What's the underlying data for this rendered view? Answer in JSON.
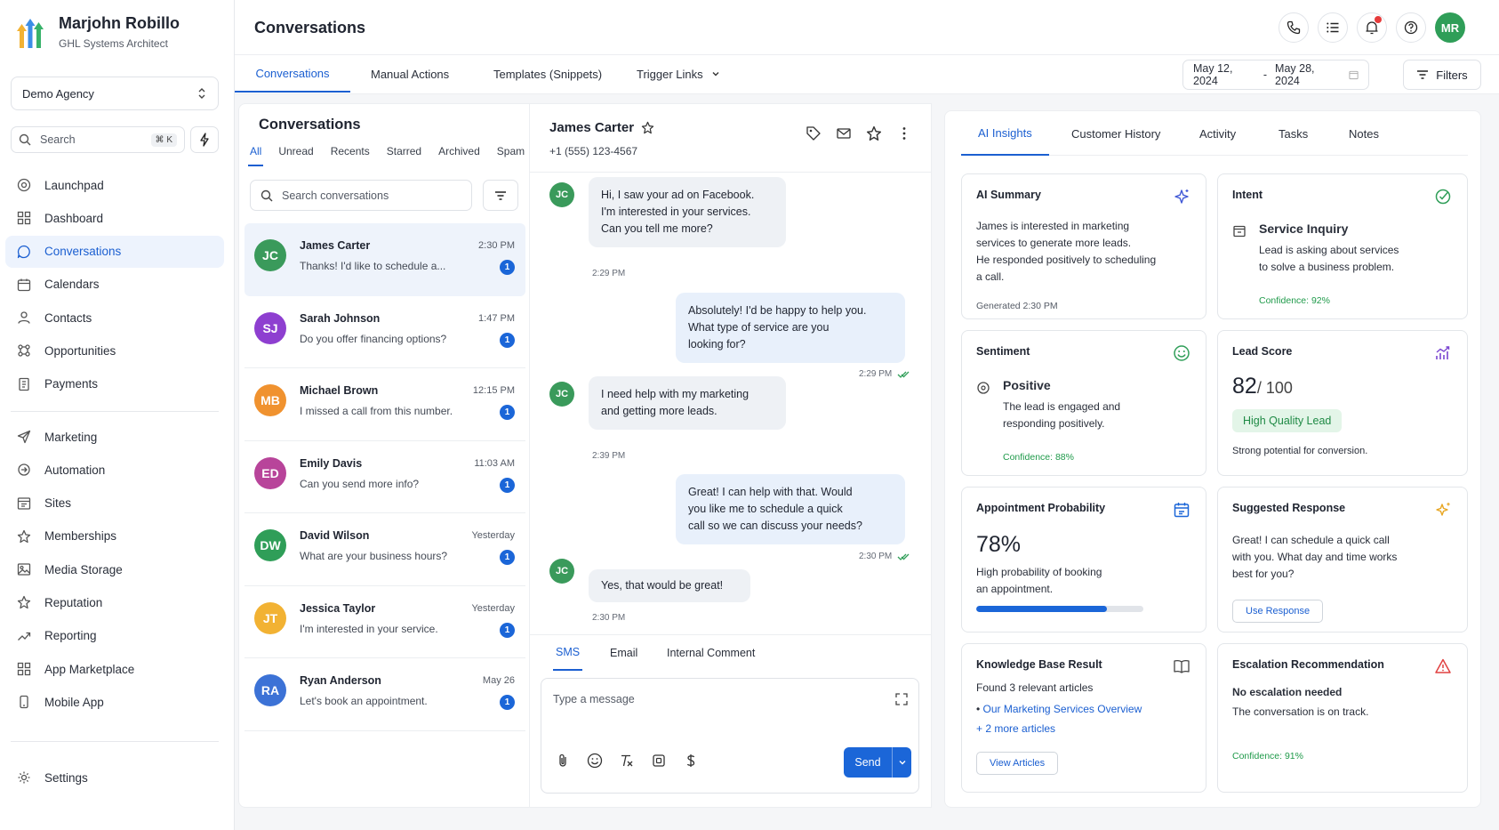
{
  "user": {
    "name": "Marjohn Robillo",
    "role": "GHL Systems Architect",
    "initials": "MR"
  },
  "agency": {
    "name": "Demo Agency"
  },
  "sidebar": {
    "search_placeholder": "Search",
    "search_shortcut": "⌘ K",
    "items": [
      {
        "label": "Launchpad",
        "icon": "rocket-icon"
      },
      {
        "label": "Dashboard",
        "icon": "grid-icon"
      },
      {
        "label": "Conversations",
        "icon": "chat-icon",
        "active": true
      },
      {
        "label": "Calendars",
        "icon": "calendar-icon"
      },
      {
        "label": "Contacts",
        "icon": "contacts-icon"
      },
      {
        "label": "Opportunities",
        "icon": "opportunities-icon"
      },
      {
        "label": "Payments",
        "icon": "payments-icon"
      }
    ],
    "items2": [
      {
        "label": "Marketing",
        "icon": "send-icon"
      },
      {
        "label": "Automation",
        "icon": "automation-icon"
      },
      {
        "label": "Sites",
        "icon": "sites-icon"
      },
      {
        "label": "Memberships",
        "icon": "memberships-icon"
      },
      {
        "label": "Media Storage",
        "icon": "image-icon"
      },
      {
        "label": "Reputation",
        "icon": "star-icon"
      },
      {
        "label": "Reporting",
        "icon": "trend-icon"
      },
      {
        "label": "App Marketplace",
        "icon": "apps-icon"
      },
      {
        "label": "Mobile App",
        "icon": "mobile-icon"
      }
    ],
    "settings_label": "Settings"
  },
  "header": {
    "title": "Conversations"
  },
  "subtabs": {
    "items": [
      "Conversations",
      "Manual Actions",
      "Templates (Snippets)",
      "Trigger Links"
    ],
    "date_start": "May 12, 2024",
    "date_sep": "-",
    "date_end": "May 28, 2024",
    "filters_label": "Filters"
  },
  "conv_list": {
    "title": "Conversations",
    "filters": [
      "All",
      "Unread",
      "Recents",
      "Starred",
      "Archived",
      "Spam"
    ],
    "search_placeholder": "Search conversations",
    "items": [
      {
        "initials": "JC",
        "name": "James Carter",
        "time": "2:30 PM",
        "preview": "Thanks! I'd like to schedule a...",
        "unread": "1",
        "color": "#3a9a5b"
      },
      {
        "initials": "SJ",
        "name": "Sarah Johnson",
        "time": "1:47 PM",
        "preview": "Do you offer financing options?",
        "unread": "1",
        "color": "#8e3fd0"
      },
      {
        "initials": "MB",
        "name": "Michael Brown",
        "time": "12:15 PM",
        "preview": "I missed a call from this number.",
        "unread": "1",
        "color": "#f0922f"
      },
      {
        "initials": "ED",
        "name": "Emily Davis",
        "time": "11:03 AM",
        "preview": "Can you send more info?",
        "unread": "1",
        "color": "#b8449a"
      },
      {
        "initials": "DW",
        "name": "David Wilson",
        "time": "Yesterday",
        "preview": "What are your business hours?",
        "unread": "1",
        "color": "#2f9e58"
      },
      {
        "initials": "JT",
        "name": "Jessica Taylor",
        "time": "Yesterday",
        "preview": "I'm interested in your service.",
        "unread": "1",
        "color": "#f2b233"
      },
      {
        "initials": "RA",
        "name": "Ryan Anderson",
        "time": "May 26",
        "preview": "Let's book an appointment.",
        "unread": "1",
        "color": "#3c72d6"
      }
    ]
  },
  "chat": {
    "name": "James Carter",
    "phone": "+1 (555) 123-4567",
    "initials": "JC",
    "messages": [
      {
        "dir": "in",
        "lines": [
          "Hi, I saw your ad on Facebook.",
          "I'm interested in your services.",
          "Can you tell me more?"
        ],
        "time": "2:29 PM"
      },
      {
        "dir": "out",
        "lines": [
          "Absolutely! I'd be happy to help you.",
          "What type of service are you",
          "looking for?"
        ],
        "time": "2:29 PM"
      },
      {
        "dir": "in",
        "lines": [
          "I need help with my marketing",
          "and getting more leads."
        ],
        "time": "2:39 PM"
      },
      {
        "dir": "out",
        "lines": [
          "Great! I can help with that. Would",
          "you like me to schedule a quick",
          "call so we can discuss your needs?"
        ],
        "time": "2:30 PM"
      },
      {
        "dir": "in",
        "lines": [
          "Yes, that would be great!"
        ],
        "time": "2:30 PM"
      }
    ],
    "composer_tabs": [
      "SMS",
      "Email",
      "Internal Comment"
    ],
    "composer_placeholder": "Type a message",
    "send_label": "Send"
  },
  "insights": {
    "tabs": [
      "AI Insights",
      "Customer History",
      "Activity",
      "Tasks",
      "Notes"
    ],
    "summary": {
      "title": "AI Summary",
      "lines": [
        "James is interested in marketing",
        "services to generate more leads.",
        "He responded positively to scheduling",
        "a call."
      ],
      "generated": "Generated 2:30 PM"
    },
    "intent": {
      "title": "Intent",
      "value": "Service Inquiry",
      "lines": [
        "Lead is asking about services",
        "to solve a business problem."
      ],
      "confidence": "Confidence: 92%"
    },
    "sentiment": {
      "title": "Sentiment",
      "value": "Positive",
      "lines": [
        "The lead is engaged and",
        "responding positively."
      ],
      "confidence": "Confidence: 88%"
    },
    "lead_score": {
      "title": "Lead Score",
      "value": "82",
      "max": "/ 100",
      "badge": "High Quality Lead",
      "note": "Strong potential for conversion."
    },
    "appointment": {
      "title": "Appointment Probability",
      "value": "78%",
      "progress": 0.78,
      "lines": [
        "High probability of booking",
        "an appointment."
      ]
    },
    "suggested": {
      "title": "Suggested Response",
      "lines": [
        "Great! I can schedule a quick call",
        "with you. What day and time works",
        "best for you?"
      ],
      "button": "Use Response"
    },
    "knowledge": {
      "title": "Knowledge Base Result",
      "found": "Found 3 relevant articles",
      "article": "Our Marketing Services Overview",
      "bullet": "•",
      "more": "+ 2 more articles",
      "button": "View Articles"
    },
    "escalation": {
      "title": "Escalation Recommendation",
      "value": "No escalation needed",
      "line": "The conversation is on track.",
      "confidence": "Confidence: 91%"
    }
  },
  "colors": {
    "accent": "#1b66d8",
    "success": "#1f9a4a",
    "danger": "#e63b3b"
  }
}
